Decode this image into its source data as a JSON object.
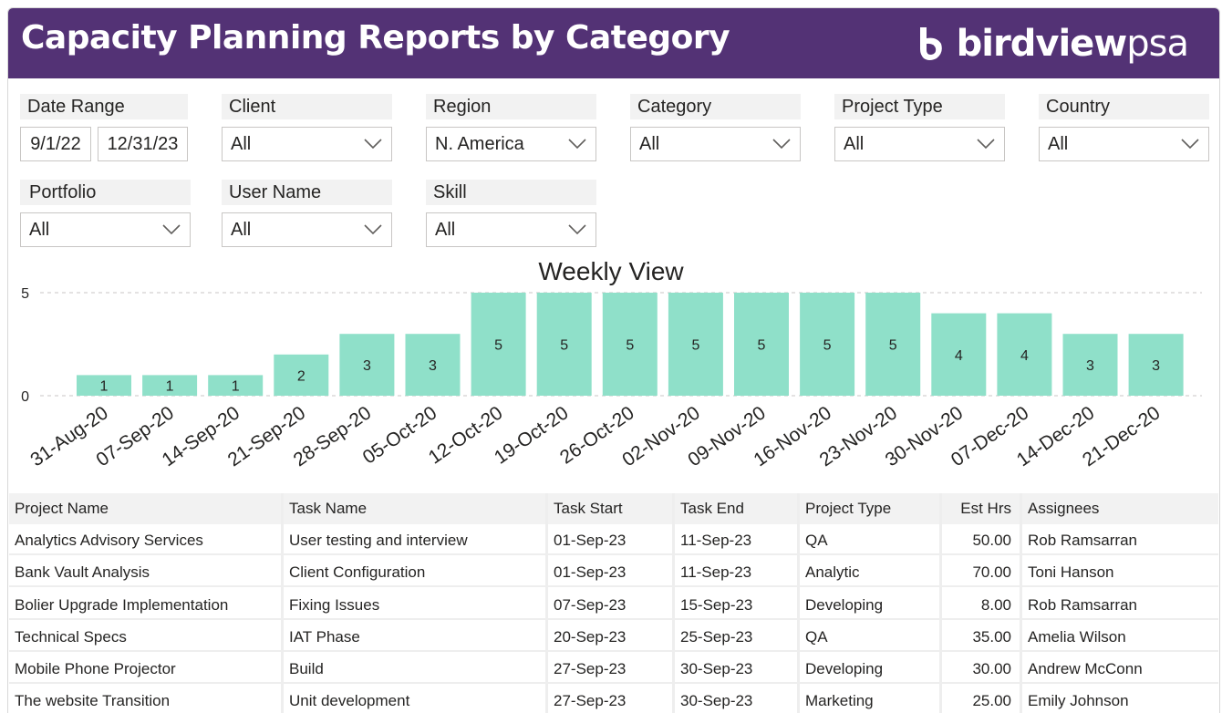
{
  "header": {
    "title": "Capacity Planning Reports by Category",
    "brand_bold": "birdview",
    "brand_light": "psa",
    "background": "#533275"
  },
  "filters": {
    "date_range": {
      "label": "Date Range",
      "start": "9/1/22",
      "end": "12/31/23"
    },
    "client": {
      "label": "Client",
      "value": "All"
    },
    "region": {
      "label": "Region",
      "value": "N. America"
    },
    "category": {
      "label": "Category",
      "value": "All"
    },
    "project_type": {
      "label": "Project Type",
      "value": "All"
    },
    "country": {
      "label": "Country",
      "value": "All"
    },
    "portfolio": {
      "label": "Portfolio",
      "value": "All"
    },
    "user_name": {
      "label": "User Name",
      "value": "All"
    },
    "skill": {
      "label": "Skill",
      "value": "All"
    }
  },
  "chart_data": {
    "type": "bar",
    "title": "Weekly View",
    "categories": [
      "31-Aug-20",
      "07-Sep-20",
      "14-Sep-20",
      "21-Sep-20",
      "28-Sep-20",
      "05-Oct-20",
      "12-Oct-20",
      "19-Oct-20",
      "26-Oct-20",
      "02-Nov-20",
      "09-Nov-20",
      "16-Nov-20",
      "23-Nov-20",
      "30-Nov-20",
      "07-Dec-20",
      "14-Dec-20",
      "21-Dec-20"
    ],
    "values": [
      1,
      1,
      1,
      2,
      3,
      3,
      5,
      5,
      5,
      5,
      5,
      5,
      5,
      4,
      4,
      3,
      3
    ],
    "ylim": [
      0,
      5
    ],
    "yticks": [
      0,
      5
    ],
    "xlabel": "",
    "ylabel": "",
    "bar_color": "#8fe0c9",
    "grid": true
  },
  "table": {
    "columns": [
      "Project Name",
      "Task Name",
      "Task Start",
      "Task End",
      "Project Type",
      "Est Hrs",
      "Assignees"
    ],
    "rows": [
      [
        "Analytics Advisory Services",
        "User testing and interview",
        "01-Sep-23",
        "11-Sep-23",
        "QA",
        "50.00",
        "Rob Ramsarran"
      ],
      [
        "Bank Vault Analysis",
        "Client Configuration",
        "01-Sep-23",
        "11-Sep-23",
        "Analytic",
        "70.00",
        "Toni Hanson"
      ],
      [
        "Bolier Upgrade Implementation",
        "Fixing Issues",
        "07-Sep-23",
        "15-Sep-23",
        "Developing",
        "8.00",
        "Rob Ramsarran"
      ],
      [
        "Technical Specs",
        "IAT Phase",
        "20-Sep-23",
        "25-Sep-23",
        "QA",
        "35.00",
        "Amelia Wilson"
      ],
      [
        "Mobile Phone Projector",
        "Build",
        "27-Sep-23",
        "30-Sep-23",
        "Developing",
        "30.00",
        "Andrew McConn"
      ],
      [
        "The website Transition",
        "Unit development",
        "27-Sep-23",
        "30-Sep-23",
        "Marketing",
        "25.00",
        "Emily Johnson"
      ]
    ]
  }
}
